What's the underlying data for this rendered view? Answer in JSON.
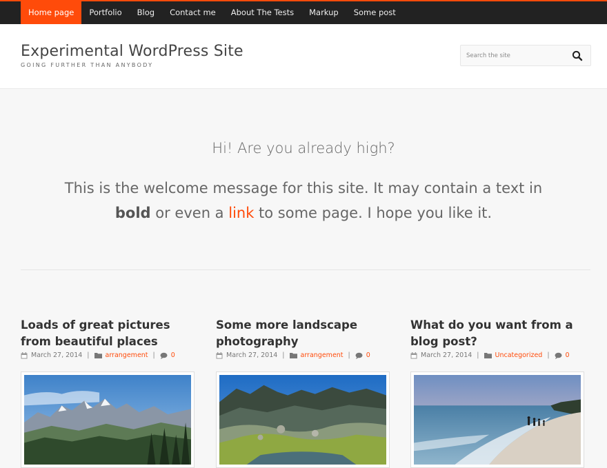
{
  "nav": {
    "items": [
      {
        "label": "Home page",
        "active": true
      },
      {
        "label": "Portfolio"
      },
      {
        "label": "Blog"
      },
      {
        "label": "Contact me"
      },
      {
        "label": "About The Tests"
      },
      {
        "label": "Markup"
      },
      {
        "label": "Some post"
      }
    ]
  },
  "header": {
    "title": "Experimental WordPress Site",
    "tagline": "GOING FURTHER THAN ANYBODY",
    "search_placeholder": "Search the site",
    "search_icon": "search-icon"
  },
  "welcome": {
    "title": "Hi! Are you already high?",
    "line_prefix": "This is the welcome message for this site. It may contain a text in ",
    "bold": "bold",
    "middle": " or even a ",
    "link": "link",
    "suffix": " to some page. I hope you like it."
  },
  "posts": [
    {
      "title": "Loads of great pictures from beautiful places",
      "date": "March 27, 2014",
      "category": "arrangement",
      "comments": "0",
      "image": "mountain-landscape"
    },
    {
      "title": "Some more landscape photography",
      "date": "March 27, 2014",
      "category": "arrangement",
      "comments": "0",
      "image": "valley-lake"
    },
    {
      "title": "What do you want from a blog post?",
      "date": "March 27, 2014",
      "category": "Uncategorized",
      "comments": "0",
      "image": "beach-people"
    }
  ],
  "colors": {
    "accent": "#ff4b0a",
    "nav_bg": "#222222",
    "body_bg": "#f7f7f7"
  }
}
